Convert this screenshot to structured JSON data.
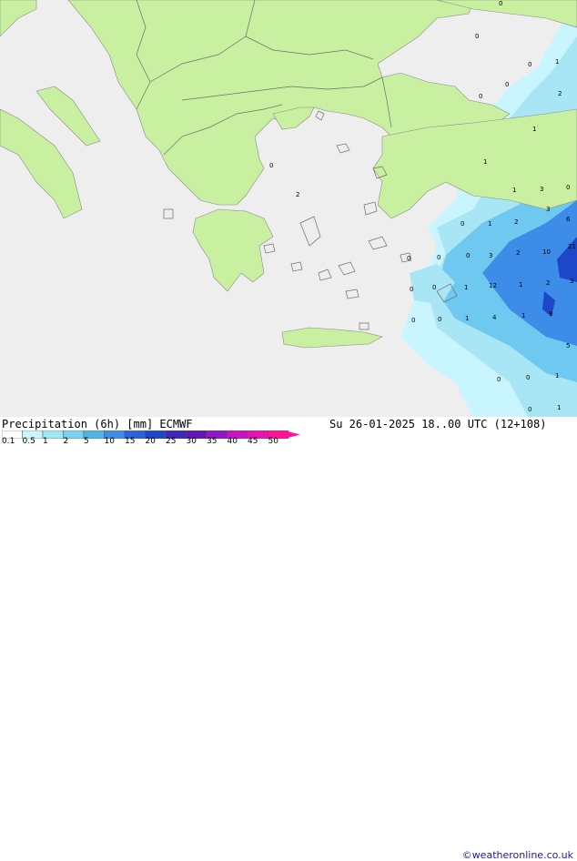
{
  "title": "Precipitation (6h) [mm] ECMWF",
  "datetime": "Su 26-01-2025 18..00 UTC (12+108)",
  "credit": "©weatheronline.co.uk",
  "colors": {
    "sea": "#eeeeee",
    "land": "#c8f0a0",
    "border": "#6e6e6e",
    "precip_light": "#a8e6f5",
    "precip_mid": "#6ec8f0",
    "precip_heavy": "#3c8ce8",
    "precip_max": "#1e46c8"
  },
  "legend": {
    "ticks": [
      "0.1",
      "0.5",
      "1",
      "2",
      "5",
      "10",
      "15",
      "20",
      "25",
      "30",
      "35",
      "40",
      "45",
      "50"
    ],
    "colors": [
      "#ffffff",
      "#c8f5ff",
      "#a0e6f5",
      "#78d2f0",
      "#50b4eb",
      "#3c8ce8",
      "#2864dc",
      "#1e46c8",
      "#3c28b4",
      "#6414b4",
      "#9614c8",
      "#c814c8",
      "#e614b4",
      "#ff1496"
    ]
  },
  "map_values": [
    {
      "text": "0"
    },
    {
      "text": "0"
    },
    {
      "text": "0"
    },
    {
      "text": "1"
    },
    {
      "text": "0"
    },
    {
      "text": "0"
    },
    {
      "text": "2"
    },
    {
      "text": "0"
    },
    {
      "text": "1"
    },
    {
      "text": "2"
    },
    {
      "text": "1"
    },
    {
      "text": "3"
    },
    {
      "text": "1"
    },
    {
      "text": "0"
    },
    {
      "text": "0"
    },
    {
      "text": "1"
    },
    {
      "text": "2"
    },
    {
      "text": "3"
    },
    {
      "text": "6"
    },
    {
      "text": "0"
    },
    {
      "text": "2"
    },
    {
      "text": "10"
    },
    {
      "text": "21"
    },
    {
      "text": "0"
    },
    {
      "text": "3"
    },
    {
      "text": "0"
    },
    {
      "text": "1"
    },
    {
      "text": "12"
    },
    {
      "text": "1"
    },
    {
      "text": "2"
    },
    {
      "text": "3"
    },
    {
      "text": "0"
    },
    {
      "text": "0"
    },
    {
      "text": "1"
    },
    {
      "text": "4"
    },
    {
      "text": "1"
    },
    {
      "text": "9"
    },
    {
      "text": "0"
    },
    {
      "text": "0"
    },
    {
      "text": "1"
    },
    {
      "text": "0"
    },
    {
      "text": "1"
    },
    {
      "text": "0"
    },
    {
      "text": "0"
    },
    {
      "text": "5"
    }
  ]
}
